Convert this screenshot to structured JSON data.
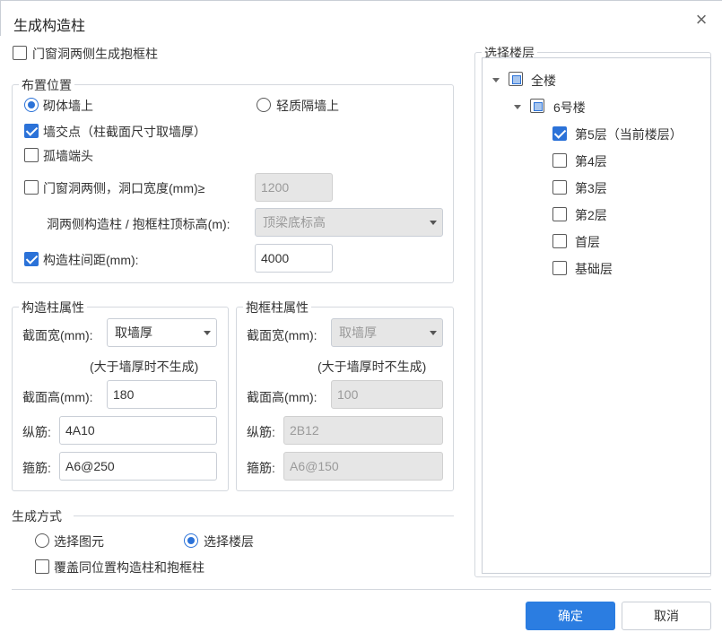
{
  "dialog": {
    "title": "生成构造柱",
    "close_label": "×"
  },
  "top_option": {
    "label": "门窗洞两侧生成抱框柱",
    "checked": false
  },
  "placement": {
    "title": "布置位置",
    "radio_masonry": "砌体墙上",
    "radio_light": "轻质隔墙上",
    "wall_intersection": "墙交点（柱截面尺寸取墙厚）",
    "isolated_wall_end": "孤墙端头",
    "opening_sides": "门窗洞两侧，洞口宽度(mm)≥",
    "opening_width_value": "1200",
    "elevation_label": "洞两侧构造柱 / 抱框柱顶标高(m):",
    "elevation_value": "顶梁底标高",
    "spacing_label": "构造柱间距(mm):",
    "spacing_value": "4000"
  },
  "column_props": {
    "title": "构造柱属性",
    "width_label": "截面宽(mm):",
    "width_value": "取墙厚",
    "note": "(大于墙厚时不生成)",
    "height_label": "截面高(mm):",
    "height_value": "180",
    "long_bar_label": "纵筋:",
    "long_bar_value": "4A10",
    "stirrup_label": "箍筋:",
    "stirrup_value": "A6@250"
  },
  "frame_props": {
    "title": "抱框柱属性",
    "width_label": "截面宽(mm):",
    "width_value": "取墙厚",
    "note": "(大于墙厚时不生成)",
    "height_label": "截面高(mm):",
    "height_value": "100",
    "long_bar_label": "纵筋:",
    "long_bar_value": "2B12",
    "stirrup_label": "箍筋:",
    "stirrup_value": "A6@150"
  },
  "generate_mode": {
    "title": "生成方式",
    "radio_element": "选择图元",
    "radio_floor": "选择楼层",
    "overwrite": "覆盖同位置构造柱和抱框柱"
  },
  "floors": {
    "title": "选择楼层",
    "root": "全楼",
    "building": "6号楼",
    "items": [
      {
        "label": "第5层（当前楼层）",
        "checked": true
      },
      {
        "label": "第4层",
        "checked": false
      },
      {
        "label": "第3层",
        "checked": false
      },
      {
        "label": "第2层",
        "checked": false
      },
      {
        "label": "首层",
        "checked": false
      },
      {
        "label": "基础层",
        "checked": false
      }
    ]
  },
  "buttons": {
    "ok": "确定",
    "cancel": "取消"
  },
  "colors": {
    "accent": "#2b7de1",
    "checkbox": "#2b72d8",
    "disabled_bg": "#e6e6e6"
  }
}
